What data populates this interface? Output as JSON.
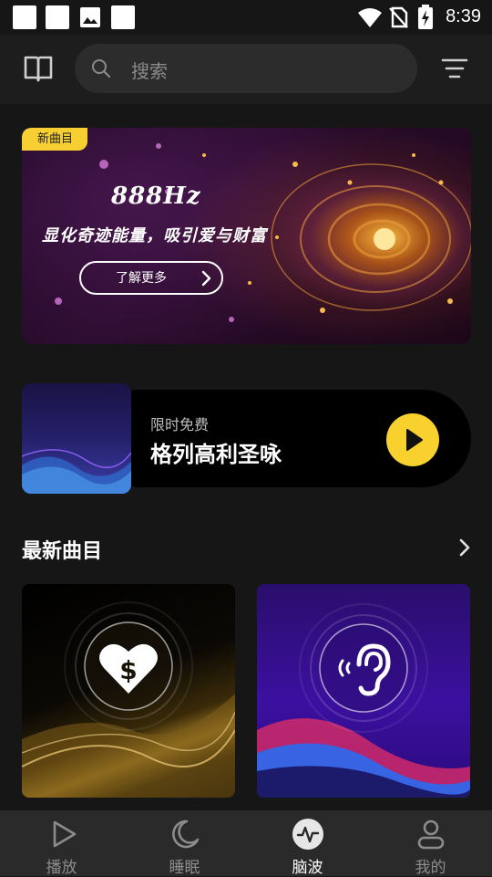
{
  "status_bar": {
    "time": "8:39"
  },
  "header": {
    "search_placeholder": "搜索"
  },
  "banner": {
    "badge": "新曲目",
    "title": "888Hz",
    "subtitle": "显化奇迹能量，吸引爱与财富",
    "button_label": "了解更多"
  },
  "promo": {
    "label": "限时免费",
    "title": "格列高利圣咏"
  },
  "section": {
    "title": "最新曲目"
  },
  "cards": [
    {
      "icon": "heart-dollar-icon"
    },
    {
      "icon": "ear-sound-icon"
    }
  ],
  "bottom_nav": {
    "items": [
      {
        "label": "播放",
        "icon": "play-icon",
        "active": false
      },
      {
        "label": "睡眠",
        "icon": "moon-icon",
        "active": false
      },
      {
        "label": "脑波",
        "icon": "brainwave-icon",
        "active": true
      },
      {
        "label": "我的",
        "icon": "person-icon",
        "active": false
      }
    ]
  },
  "colors": {
    "accent": "#f8d12f",
    "background": "#161616",
    "nav_background": "#2a2a2a"
  }
}
